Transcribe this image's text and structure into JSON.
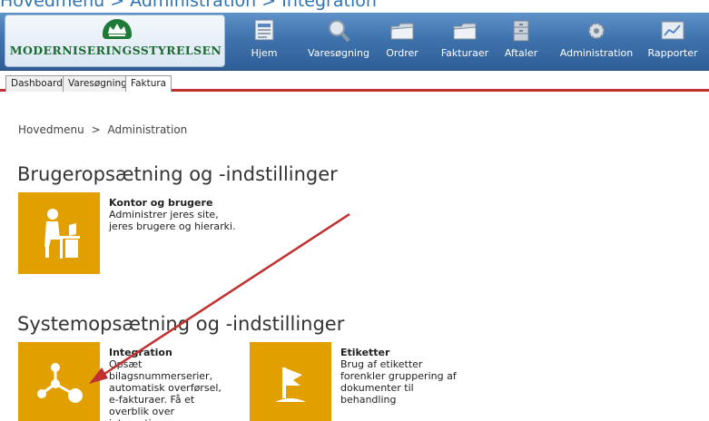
{
  "page_heading": "Hovedmenu > Administration > Integration",
  "header": {
    "logo_text": "MODERNISERINGSSTYRELSEN",
    "nav": [
      {
        "label": "Hjem",
        "icon": "home-document-icon"
      },
      {
        "label": "Varesøgning",
        "icon": "magnifier-icon"
      },
      {
        "label": "Ordrer",
        "icon": "folder-icon"
      },
      {
        "label": "Fakturaer",
        "icon": "folder-icon"
      },
      {
        "label": "Aftaler",
        "icon": "archive-cabinet-icon"
      },
      {
        "label": "Administration",
        "icon": "gear-icon"
      },
      {
        "label": "Rapporter",
        "icon": "chart-icon"
      }
    ]
  },
  "tabs": [
    {
      "label": "Dashboard",
      "active": false
    },
    {
      "label": "Varesøgning",
      "active": false
    },
    {
      "label": "Faktura",
      "active": true
    }
  ],
  "breadcrumb": {
    "root": "Hovedmenu",
    "separator": ">",
    "current": "Administration"
  },
  "sections": {
    "user_setup": {
      "title": "Brugeropsætning og -indstillinger",
      "tiles": [
        {
          "title": "Kontor og brugere",
          "description": "Administrer jeres site, jeres brugere og hierarki.",
          "icon": "person-at-desk-icon"
        }
      ]
    },
    "system_setup": {
      "title": "Systemopsætning og -indstillinger",
      "tiles": [
        {
          "title": "Integration",
          "description": "Opsæt bilagsnummerserier, automatisk overførsel, e-fakturaer. Få et overblik over integrationen.",
          "icon": "network-nodes-icon"
        },
        {
          "title": "Etiketter",
          "description": "Brug af etiketter forenkler gruppering af dokumenter til behandling",
          "icon": "flag-icon"
        }
      ]
    }
  },
  "colors": {
    "tile_accent": "#e19f00",
    "header_blue": "#3f73ad",
    "tab_underline": "#c0302f",
    "annotation_arrow": "#c0302f"
  }
}
